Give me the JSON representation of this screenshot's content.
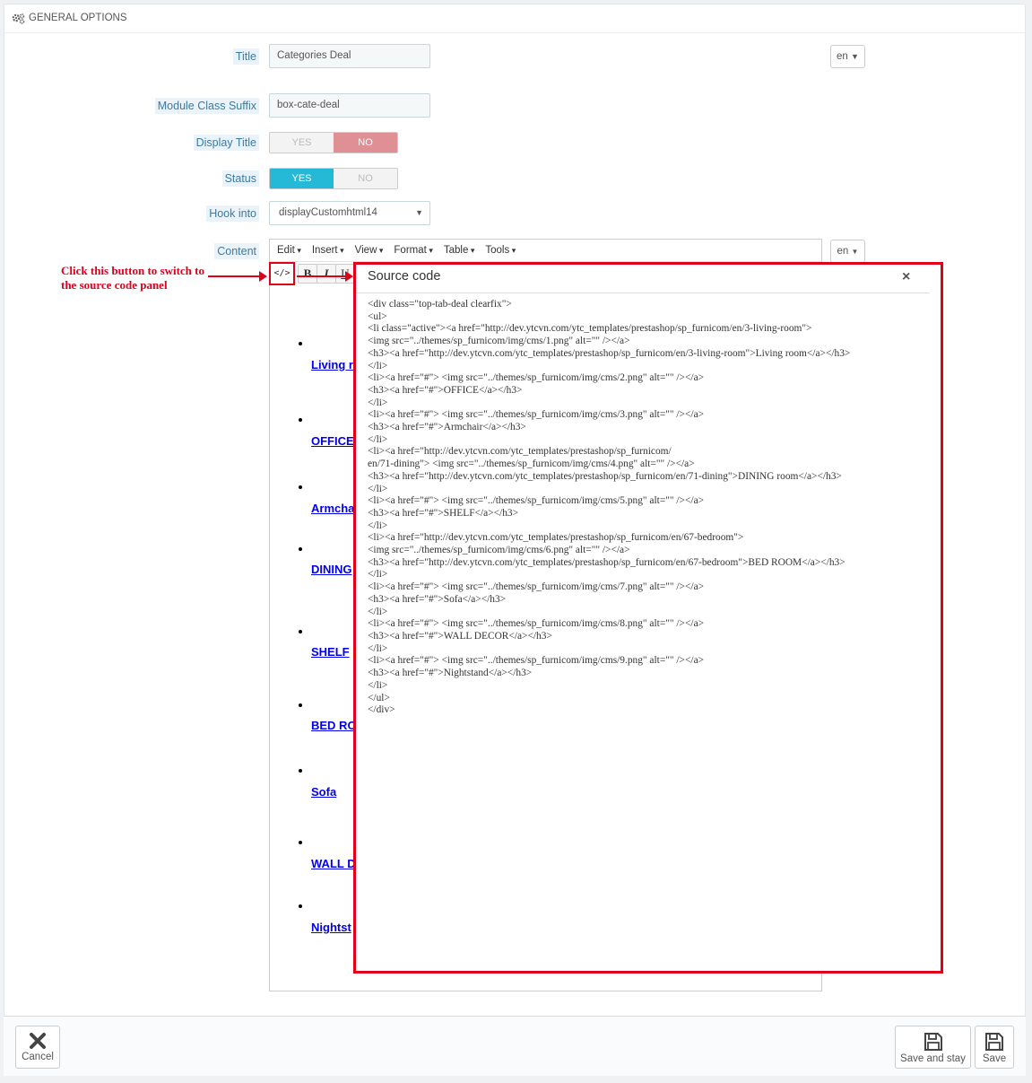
{
  "panel": {
    "heading": "GENERAL OPTIONS",
    "heading_icon": "gears-icon"
  },
  "form": {
    "title_label": "Title",
    "title_value": "Categories Deal",
    "title_lang": "en",
    "suffix_label": "Module Class Suffix",
    "suffix_value": "box-cate-deal",
    "display_title_label": "Display Title",
    "display_title_yes": "YES",
    "display_title_no": "NO",
    "display_title_state": "NO",
    "status_label": "Status",
    "status_yes": "YES",
    "status_no": "NO",
    "status_state": "YES",
    "hook_label": "Hook into",
    "hook_value": "displayCustomhtml14",
    "content_label": "Content",
    "content_lang": "en"
  },
  "editor": {
    "menu": [
      "Edit",
      "Insert",
      "View",
      "Format",
      "Table",
      "Tools"
    ],
    "toolbar": {
      "code": "</>",
      "bold": "B",
      "italic": "I",
      "underline": "U"
    },
    "items": [
      "Living r",
      "OFFICE",
      "Armcha",
      "DINING",
      "SHELF",
      "BED RO",
      "Sofa",
      "WALL D",
      "Nightst"
    ]
  },
  "annotation": {
    "text": "Click this button to switch to the source code panel",
    "color": "#e1001a"
  },
  "source_modal": {
    "title": "Source code",
    "close": "×",
    "code_lines": [
      "<div class=\"top-tab-deal clearfix\">",
      "<ul>",
      "<li class=\"active\"><a href=\"http://dev.ytcvn.com/ytc_templates/prestashop/sp_furnicom/en/3-living-room\">",
      "<img src=\"../themes/sp_furnicom/img/cms/1.png\" alt=\"\" /></a>",
      "<h3><a href=\"http://dev.ytcvn.com/ytc_templates/prestashop/sp_furnicom/en/3-living-room\">Living room</a></h3>",
      "</li>",
      "<li><a href=\"#\"> <img src=\"../themes/sp_furnicom/img/cms/2.png\" alt=\"\" /></a>",
      "<h3><a href=\"#\">OFFICE</a></h3>",
      "</li>",
      "<li><a href=\"#\"> <img src=\"../themes/sp_furnicom/img/cms/3.png\" alt=\"\" /></a>",
      "<h3><a href=\"#\">Armchair</a></h3>",
      "</li>",
      "<li><a href=\"http://dev.ytcvn.com/ytc_templates/prestashop/sp_furnicom/",
      "en/71-dining\"> <img src=\"../themes/sp_furnicom/img/cms/4.png\" alt=\"\" /></a>",
      "<h3><a href=\"http://dev.ytcvn.com/ytc_templates/prestashop/sp_furnicom/en/71-dining\">DINING room</a></h3>",
      "</li>",
      "<li><a href=\"#\"> <img src=\"../themes/sp_furnicom/img/cms/5.png\" alt=\"\" /></a>",
      "<h3><a href=\"#\">SHELF</a></h3>",
      "</li>",
      "<li><a href=\"http://dev.ytcvn.com/ytc_templates/prestashop/sp_furnicom/en/67-bedroom\">",
      "<img src=\"../themes/sp_furnicom/img/cms/6.png\" alt=\"\" /></a>",
      "<h3><a href=\"http://dev.ytcvn.com/ytc_templates/prestashop/sp_furnicom/en/67-bedroom\">BED ROOM</a></h3>",
      "</li>",
      "<li><a href=\"#\"> <img src=\"../themes/sp_furnicom/img/cms/7.png\" alt=\"\" /></a>",
      "<h3><a href=\"#\">Sofa</a></h3>",
      "</li>",
      "<li><a href=\"#\"> <img src=\"../themes/sp_furnicom/img/cms/8.png\" alt=\"\" /></a>",
      "<h3><a href=\"#\">WALL DECOR</a></h3>",
      "</li>",
      "<li><a href=\"#\"> <img src=\"../themes/sp_furnicom/img/cms/9.png\" alt=\"\" /></a>",
      "<h3><a href=\"#\">Nightstand</a></h3>",
      "</li>",
      "</ul>",
      "</div>"
    ]
  },
  "footer": {
    "cancel": "Cancel",
    "cancel_icon": "close-icon",
    "save_and_stay": "Save and stay",
    "save": "Save",
    "save_icon": "floppy-disk-icon"
  }
}
